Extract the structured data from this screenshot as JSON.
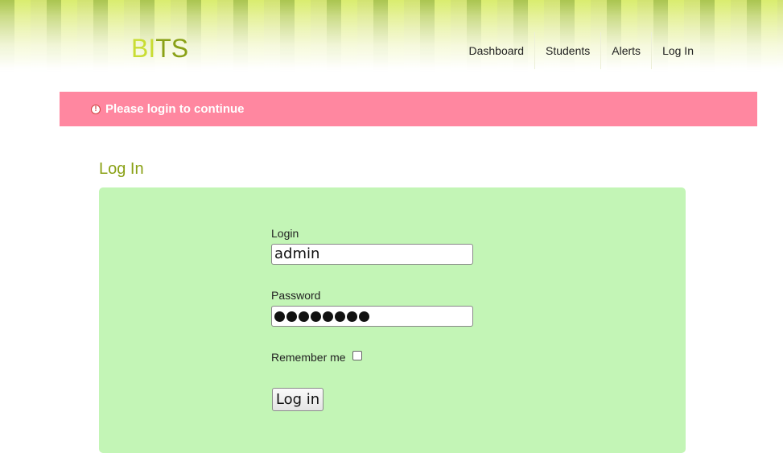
{
  "header": {
    "logo_part1": "BI",
    "logo_part2": "TS",
    "nav": [
      {
        "label": "Dashboard"
      },
      {
        "label": "Students"
      },
      {
        "label": "Alerts"
      },
      {
        "label": "Log In"
      }
    ]
  },
  "flash": {
    "icon": "warning-icon",
    "message": "Please login to continue",
    "color": "#ff87a0"
  },
  "page": {
    "title": "Log In"
  },
  "form": {
    "login_label": "Login",
    "login_value": "admin",
    "password_label": "Password",
    "password_length": 8,
    "remember_label": "Remember me",
    "remember_checked": false,
    "submit_label": "Log in"
  },
  "colors": {
    "accent_green": "#8aa116",
    "logo_light": "#c9dd33",
    "panel_bg": "#c3f5b6"
  }
}
